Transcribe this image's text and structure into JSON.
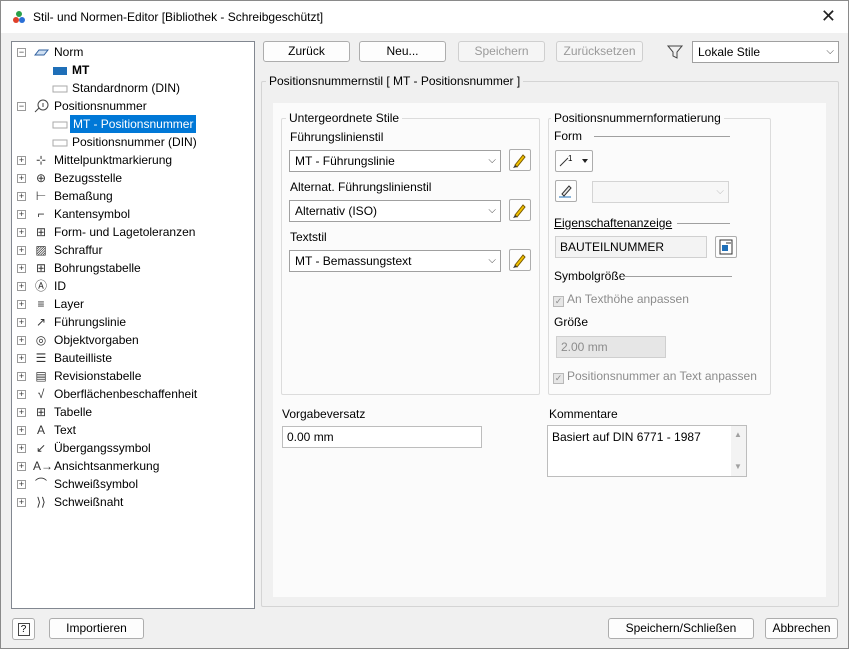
{
  "window": {
    "title": "Stil- und Normen-Editor [Bibliothek - Schreibgeschützt]",
    "close": "✕"
  },
  "toolbar": {
    "back": "Zurück",
    "new": "Neu...",
    "save": "Speichern",
    "reset": "Zurücksetzen",
    "filter_value": "Lokale Stile"
  },
  "tree": {
    "norm": "Norm",
    "mt": "MT",
    "standardnorm": "Standardnorm (DIN)",
    "positionsnummer": "Positionsnummer",
    "mt_pos": "MT - Positionsnummer",
    "pos_din": "Positionsnummer (DIN)",
    "items": [
      "Mittelpunktmarkierung",
      "Bezugsstelle",
      "Bemaßung",
      "Kantensymbol",
      "Form- und Lagetoleranzen",
      "Schraffur",
      "Bohrungstabelle",
      "ID",
      "Layer",
      "Führungslinie",
      "Objektvorgaben",
      "Bauteilliste",
      "Revisionstabelle",
      "Oberflächenbeschaffenheit",
      "Tabelle",
      "Text",
      "Übergangssymbol",
      "Ansichtsanmerkung",
      "Schweißsymbol",
      "Schweißnaht"
    ]
  },
  "main": {
    "section_title": "Positionsnummernstil [ MT - Positionsnummer ]",
    "sub_styles": {
      "group": "Untergeordnete Stile",
      "leader_label": "Führungslinienstil",
      "leader_value": "MT - Führungslinie",
      "alt_leader_label": "Alternat. Führungslinienstil",
      "alt_leader_value": "Alternativ (ISO)",
      "text_label": "Textstil",
      "text_value": "MT - Bemassungstext"
    },
    "formatting": {
      "group": "Positionsnummernformatierung",
      "form": "Form",
      "props_label": "Eigenschaftenanzeige",
      "props_value": "BAUTEILNUMMER",
      "symbol_size": "Symbolgröße",
      "fit_text_height": "An Texthöhe anpassen",
      "size_label": "Größe",
      "size_value": "2.00 mm",
      "fit_to_text": "Positionsnummer an Text anpassen"
    },
    "offset_label": "Vorgabeversatz",
    "offset_value": "0.00 mm",
    "comments_label": "Kommentare",
    "comments_value": "Basiert auf DIN 6771 - 1987"
  },
  "footer": {
    "help": "?",
    "import": "Importieren",
    "save_close": "Speichern/Schließen",
    "cancel": "Abbrechen"
  }
}
